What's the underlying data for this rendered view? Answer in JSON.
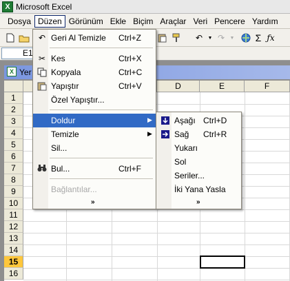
{
  "app": {
    "title": "Microsoft Excel"
  },
  "menubar": {
    "items": [
      "Dosya",
      "Düzen",
      "Görünüm",
      "Ekle",
      "Biçim",
      "Araçlar",
      "Veri",
      "Pencere",
      "Yardım"
    ],
    "active": "Düzen"
  },
  "formulabar": {
    "namebox": "E1"
  },
  "workbook": {
    "title": "Yer"
  },
  "sheet": {
    "columns": [
      "D",
      "E",
      "F"
    ],
    "rows": [
      "1",
      "2",
      "3",
      "4",
      "5",
      "6",
      "7",
      "8",
      "9",
      "10",
      "11",
      "12",
      "13",
      "14",
      "15",
      "16"
    ],
    "selected_row": "15"
  },
  "edit_menu": {
    "items": [
      {
        "label": "Geri Al Temizle",
        "shortcut": "Ctrl+Z",
        "icon": "undo-icon"
      },
      {
        "label": "Kes",
        "shortcut": "Ctrl+X",
        "icon": "scissors-icon"
      },
      {
        "label": "Kopyala",
        "shortcut": "Ctrl+C",
        "icon": "copy-icon"
      },
      {
        "label": "Yapıştır",
        "shortcut": "Ctrl+V",
        "icon": "paste-icon"
      },
      {
        "label": "Özel Yapıştır...",
        "shortcut": ""
      },
      {
        "label": "Doldur",
        "shortcut": "",
        "submenu": true,
        "highlighted": true
      },
      {
        "label": "Temizle",
        "shortcut": "",
        "submenu": true
      },
      {
        "label": "Sil...",
        "shortcut": ""
      },
      {
        "label": "Bul...",
        "shortcut": "Ctrl+F",
        "icon": "binoculars-icon"
      },
      {
        "label": "Bağlantılar...",
        "shortcut": "",
        "disabled": true
      }
    ],
    "more": "»"
  },
  "fill_submenu": {
    "items": [
      {
        "label": "Aşağı",
        "shortcut": "Ctrl+D",
        "icon": "fill-down-icon"
      },
      {
        "label": "Sağ",
        "shortcut": "Ctrl+R",
        "icon": "fill-right-icon"
      },
      {
        "label": "Yukarı",
        "shortcut": ""
      },
      {
        "label": "Sol",
        "shortcut": ""
      },
      {
        "label": "Seriler...",
        "shortcut": ""
      },
      {
        "label": "İki Yana Yasla",
        "shortcut": ""
      }
    ],
    "more": "»"
  },
  "colors": {
    "highlight": "#316ac5",
    "selected_row_header": "#ffc73c"
  }
}
